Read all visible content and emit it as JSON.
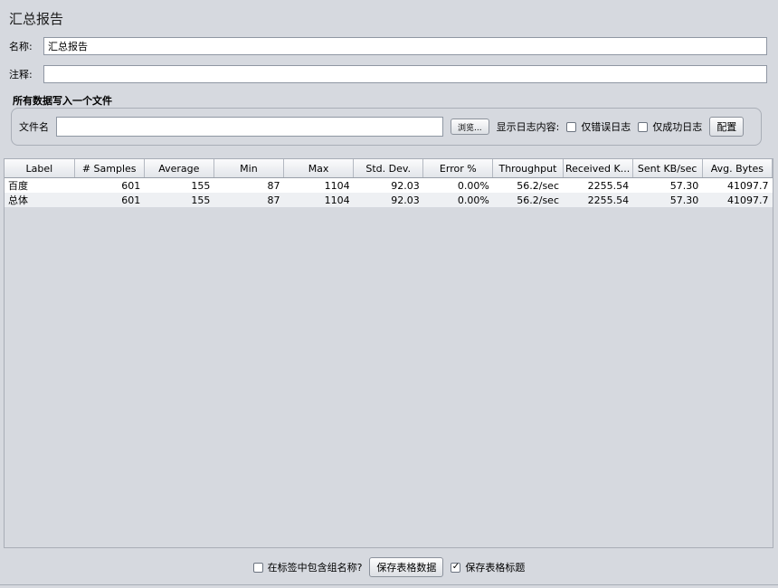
{
  "page": {
    "title": "汇总报告"
  },
  "name_field": {
    "label": "名称:",
    "value": "汇总报告"
  },
  "comment_field": {
    "label": "注释:",
    "value": ""
  },
  "file_section": {
    "title": "所有数据写入一个文件",
    "filename_label": "文件名",
    "filename_value": "",
    "browse_label": "浏览...",
    "log_content_label": "显示日志内容:",
    "errors_only_label": "仅错误日志",
    "errors_only_checked": false,
    "success_only_label": "仅成功日志",
    "success_only_checked": false,
    "config_label": "配置"
  },
  "table": {
    "columns": [
      "Label",
      "# Samples",
      "Average",
      "Min",
      "Max",
      "Std. Dev.",
      "Error %",
      "Throughput",
      "Received K...",
      "Sent KB/sec",
      "Avg. Bytes"
    ],
    "rows": [
      [
        "百度",
        "601",
        "155",
        "87",
        "1104",
        "92.03",
        "0.00%",
        "56.2/sec",
        "2255.54",
        "57.30",
        "41097.7"
      ],
      [
        "总体",
        "601",
        "155",
        "87",
        "1104",
        "92.03",
        "0.00%",
        "56.2/sec",
        "2255.54",
        "57.30",
        "41097.7"
      ]
    ]
  },
  "bottom": {
    "include_group_label": "在标签中包含组名称?",
    "include_group_checked": false,
    "save_data_label": "保存表格数据",
    "save_header_label": "保存表格标题",
    "save_header_checked": true
  }
}
